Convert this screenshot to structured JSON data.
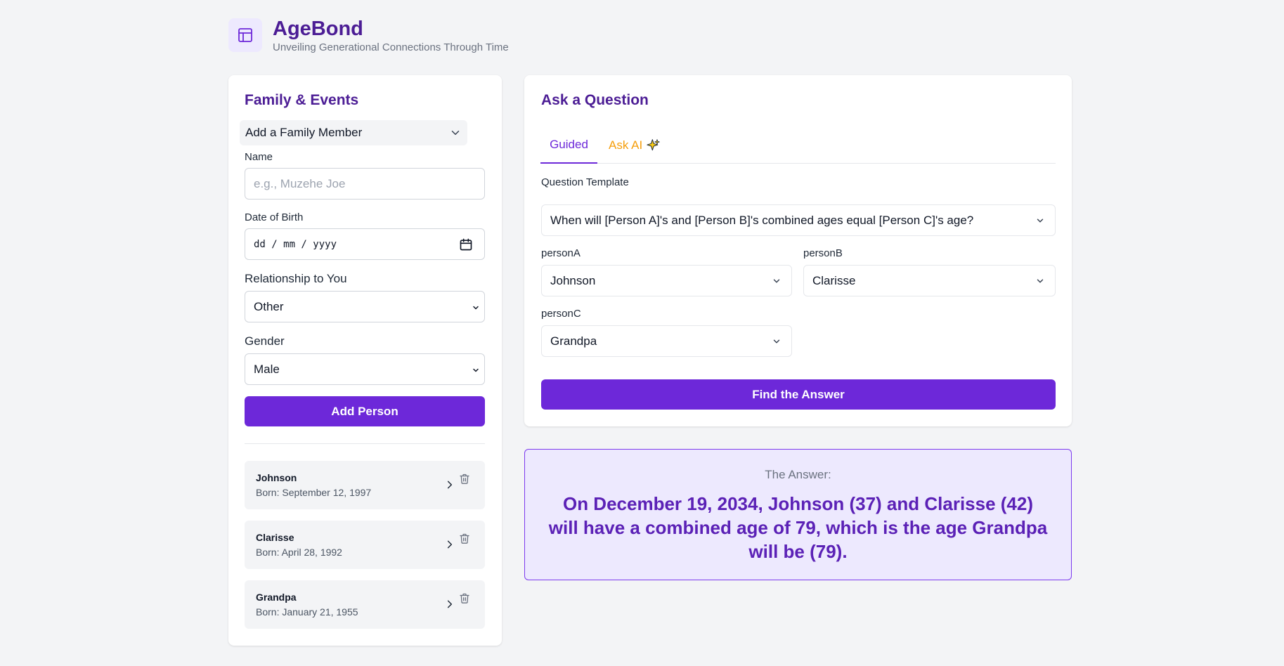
{
  "app": {
    "title": "AgeBond",
    "subtitle": "Unveiling Generational Connections Through Time",
    "logo_icon": "layout-icon"
  },
  "colors": {
    "accent": "#6d28d9",
    "brand": "#4c1d95",
    "ai_tab": "#f59e0b",
    "answer_bg": "#ede9fe"
  },
  "family_panel": {
    "title": "Family & Events",
    "accordion_label": "Add a Family Member",
    "name_label": "Name",
    "name_placeholder": "e.g., Muzehe Joe",
    "dob_label": "Date of Birth",
    "dob_placeholder": "dd / mm / yyyy",
    "relationship_label": "Relationship to You",
    "relationship_value": "Other",
    "gender_label": "Gender",
    "gender_value": "Male",
    "add_button": "Add Person",
    "people": [
      {
        "name": "Johnson",
        "born": "Born: September 12, 1997"
      },
      {
        "name": "Clarisse",
        "born": "Born: April 28, 1992"
      },
      {
        "name": "Grandpa",
        "born": "Born: January 21, 1955"
      }
    ]
  },
  "question_panel": {
    "title": "Ask a Question",
    "tabs": [
      {
        "label": "Guided",
        "active": true
      },
      {
        "label": "Ask AI",
        "icon": "sparkle-icon"
      }
    ],
    "template_label": "Question Template",
    "template_value": "When will [Person A]'s and [Person B]'s combined ages equal [Person C]'s age?",
    "personA_label": "personA",
    "personA_value": "Johnson",
    "personB_label": "personB",
    "personB_value": "Clarisse",
    "personC_label": "personC",
    "personC_value": "Grandpa",
    "find_button": "Find the Answer"
  },
  "answer": {
    "label": "The Answer:",
    "text": "On December 19, 2034, Johnson (37) and Clarisse (42) will have a combined age of 79, which is the age Grandpa will be (79)."
  }
}
